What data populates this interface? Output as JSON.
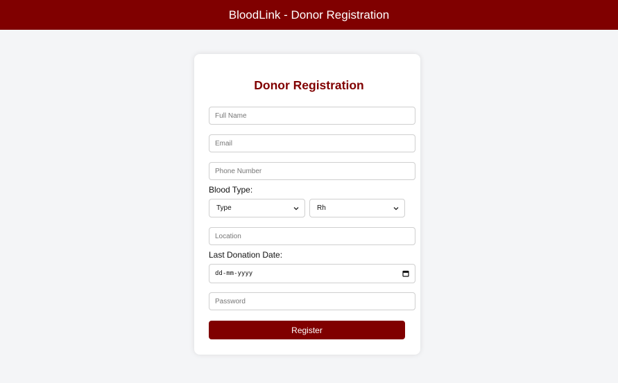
{
  "header": {
    "title": "BloodLink - Donor Registration"
  },
  "form": {
    "title": "Donor Registration",
    "full_name_placeholder": "Full Name",
    "email_placeholder": "Email",
    "phone_placeholder": "Phone Number",
    "blood_type_label": "Blood Type:",
    "type_select_value": "Type",
    "rh_select_value": "Rh",
    "location_placeholder": "Location",
    "last_donation_label": "Last Donation Date:",
    "date_value": "dd-mm-yyyy",
    "password_placeholder": "Password",
    "register_label": "Register"
  },
  "colors": {
    "brand": "#800000",
    "background": "#f4f5f7",
    "card": "#ffffff"
  },
  "icons": {
    "select_arrow": "chevron-down-icon",
    "date_picker": "calendar-icon"
  }
}
